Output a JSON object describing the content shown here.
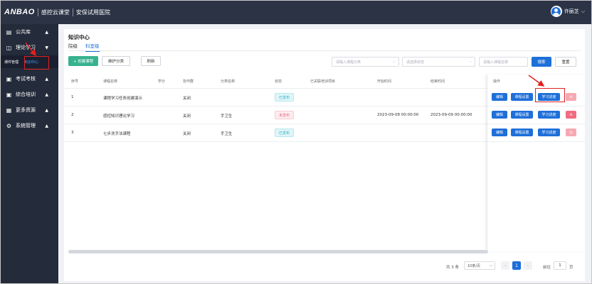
{
  "header": {
    "logo": "ANBAO",
    "brand": "感控云课堂",
    "hospital": "安保试用医院",
    "user_name": "许丽芝"
  },
  "sidebar": {
    "items": [
      {
        "label": "公共库",
        "icon": "database-icon",
        "arrow": "▲"
      },
      {
        "label": "理论学习",
        "icon": "book-icon",
        "arrow": "▼"
      },
      {
        "label": "考试考核",
        "icon": "exam-icon",
        "arrow": "▲"
      },
      {
        "label": "综合培训",
        "icon": "training-icon",
        "arrow": "▲"
      },
      {
        "label": "更多资源",
        "icon": "grid-icon",
        "arrow": "▲"
      },
      {
        "label": "系统管理",
        "icon": "gear-icon",
        "arrow": "▲"
      }
    ],
    "sub_items": {
      "course_mgmt": "课件管理",
      "knowledge_center": "知识中心"
    }
  },
  "main": {
    "title": "知识中心",
    "tabs": [
      {
        "label": "院级",
        "active": false
      },
      {
        "label": "科室级",
        "active": true
      }
    ],
    "toolbar": {
      "create": "+ 创建课程",
      "maintain_category": "维护分类",
      "refresh": "刷新",
      "category_placeholder": "请输入课程分类",
      "status_placeholder": "请选择状态",
      "name_placeholder": "请输入课程名称",
      "search": "搜索",
      "reset": "重置"
    },
    "table": {
      "columns": [
        "序号",
        "课程名称",
        "学分",
        "协作群",
        "分类名称",
        "状态",
        "已关联培训项目",
        "开始时间",
        "结束时间",
        "操作"
      ],
      "rows": [
        {
          "index": "1",
          "name": "课程学习任务创建演示",
          "credit": "",
          "collab": "关闭",
          "category": "",
          "status": "已发布",
          "status_type": "published",
          "linked": "",
          "start": "",
          "end": ""
        },
        {
          "index": "2",
          "name": "感控知识理论学习",
          "credit": "",
          "collab": "关闭",
          "category": "手卫生",
          "status": "未发布",
          "status_type": "unpublished",
          "linked": "",
          "start": "2023-09-08 00:00:00",
          "end": "2023-09-09 00:00:00"
        },
        {
          "index": "3",
          "name": "七步洗手法课程",
          "credit": "",
          "collab": "关闭",
          "category": "手卫生",
          "status": "已发布",
          "status_type": "published",
          "linked": "",
          "start": "",
          "end": ""
        }
      ],
      "op_labels": {
        "edit": "编辑",
        "settings": "课程设置",
        "progress": "学习进度",
        "delete": "⊖"
      }
    },
    "pagination": {
      "total": "共 3 条",
      "page_size": "10条/页",
      "prev": "‹",
      "current": "1",
      "next": "›",
      "goto_label": "前往",
      "goto_value": "1",
      "page_unit": "页"
    }
  },
  "colors": {
    "primary": "#1e6fd9",
    "sidebar_bg": "#242b3a",
    "topbar_bg": "#2b3345",
    "annotation": "#e02020"
  }
}
